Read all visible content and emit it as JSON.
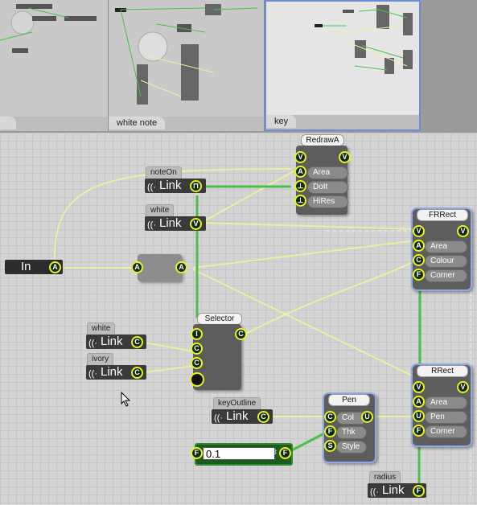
{
  "thumbnails": [
    {
      "label": "",
      "selected": false
    },
    {
      "label": "white note",
      "selected": false
    },
    {
      "label": "key",
      "selected": true
    }
  ],
  "nodes": {
    "in_node": {
      "label": "In",
      "port": "A"
    },
    "noteon_link": {
      "tab": "noteOn",
      "label": "Link"
    },
    "white_link_top": {
      "tab": "white",
      "label": "Link"
    },
    "passthrough": {
      "in_port": "A",
      "out_port": "A"
    },
    "redraw": {
      "title": "RedrawA",
      "ports_left": [
        "V",
        "A",
        "⊥",
        "⊥"
      ],
      "labels": [
        "Area",
        "DoIt",
        "HiRes"
      ],
      "out_port": "V"
    },
    "frrect": {
      "title": "FRRect",
      "labels": [
        "Area",
        "Colour",
        "Corner"
      ],
      "in_ports": [
        "V",
        "A",
        "C",
        "F"
      ],
      "out_port": "V"
    },
    "rrect": {
      "title": "RRect",
      "labels": [
        "Area",
        "Pen",
        "Corner"
      ],
      "in_ports": [
        "V",
        "A",
        "U",
        "F"
      ],
      "out_port": "V"
    },
    "selector": {
      "title": "Selector",
      "in_ports": [
        "I",
        "C",
        "C"
      ],
      "out_port": "C"
    },
    "white_link": {
      "tab": "white",
      "label": "Link"
    },
    "ivory_link": {
      "tab": "ivory",
      "label": "Link"
    },
    "keyoutline_link": {
      "tab": "keyOutline",
      "label": "Link"
    },
    "pen": {
      "title": "Pen",
      "labels": [
        "Col",
        "Thk",
        "Style"
      ],
      "in_ports": [
        "C",
        "F",
        "S"
      ],
      "out_port": "U"
    },
    "number": {
      "value": "0.1",
      "in_port": "F",
      "out_port": "F"
    },
    "radius_link": {
      "tab": "radius",
      "label": "Link"
    }
  },
  "colors": {
    "wire_green": "#4bbf4b",
    "wire_yellow": "#eef2a0",
    "port_ring": "#e9f31c",
    "selection": "#8ea9e6"
  }
}
